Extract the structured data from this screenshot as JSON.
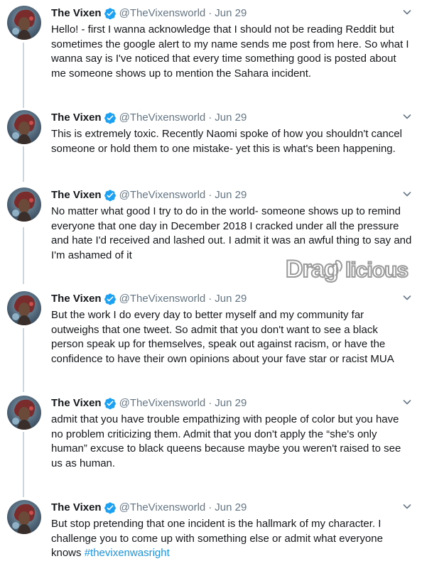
{
  "author": {
    "name": "The Vixen",
    "handle": "@TheVixensworld",
    "separator": "·",
    "verified": true
  },
  "tweets": [
    {
      "date": "Jun 29",
      "text": "Hello! - first I wanna acknowledge that I should not be reading Reddit but sometimes the google alert to my name sends me post from here. So what I wanna say is I've noticed that every time something good is posted about me someone shows up to mention the Sahara incident."
    },
    {
      "date": "Jun 29",
      "text": "This is extremely toxic. Recently Naomi spoke of how you shouldn't cancel someone or hold them to one mistake- yet this is what's been happening."
    },
    {
      "date": "Jun 29",
      "text": "No matter what good I try to do in the world- someone shows up to remind everyone that one day in December 2018 I cracked under all the pressure and hate I'd received and lashed out. I admit it was an awful thing to say and I'm ashamed of it"
    },
    {
      "date": "Jun 29",
      "text": "But the work I do every day to better myself and my community far outweighs that one tweet. So admit that you don't want to see a black person speak up for themselves, speak out against racism, or have the confidence to have their own opinions about your fave star or racist MUA"
    },
    {
      "date": "Jun 29",
      "text": "admit that you have trouble empathizing with people of color but you have no problem criticizing them. Admit that you don't apply the “she's only human” excuse to black queens because maybe you weren't raised to see us as human."
    },
    {
      "date": "Jun 29",
      "text": "But stop pretending that one incident is the hallmark of my character. I challenge you to come up with something else or admit what everyone knows ",
      "hashtag": "#thevixenwasright"
    }
  ],
  "watermark": {
    "text_part1": "Drag",
    "text_part2": "licious"
  },
  "colors": {
    "text": "#14171a",
    "secondary": "#657786",
    "verified": "#1da1f2",
    "hashtag": "#1b95e0",
    "thread_line": "#ccd6dd",
    "watermark": "#9a9a9a"
  },
  "icons": {
    "verified": "verified-badge-icon",
    "more": "chevron-down-icon"
  }
}
